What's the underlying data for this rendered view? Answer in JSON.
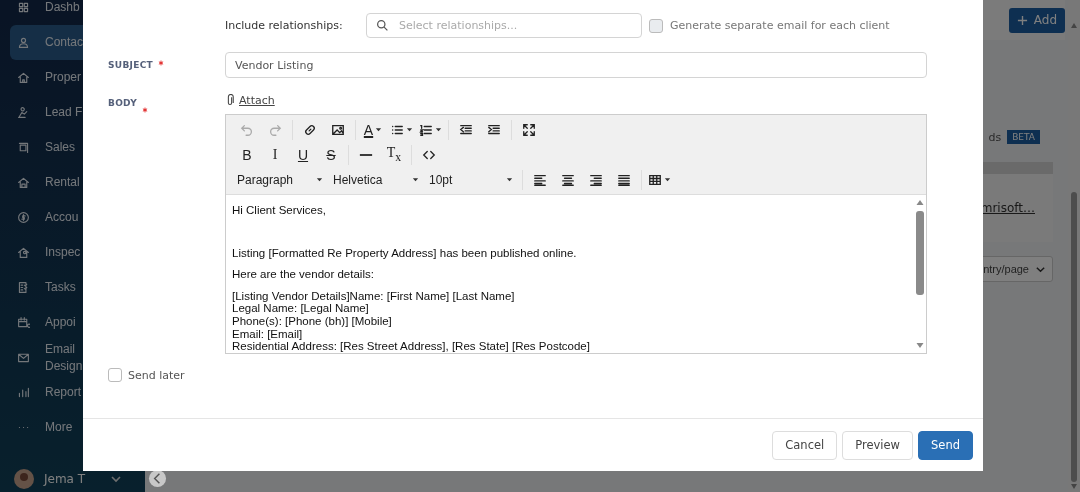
{
  "sidebar": {
    "items": [
      {
        "label": "Dashb",
        "selected": false
      },
      {
        "label": "Contac",
        "selected": true
      },
      {
        "label": "Proper",
        "selected": false
      },
      {
        "label": "Lead F",
        "selected": false
      },
      {
        "label": "Sales",
        "selected": false
      },
      {
        "label": "Rental",
        "selected": false
      },
      {
        "label": "Accou",
        "selected": false
      },
      {
        "label": "Inspec",
        "selected": false
      },
      {
        "label": "Tasks",
        "selected": false
      },
      {
        "label": "Appoi",
        "selected": false
      },
      {
        "label": "Email Design",
        "selected": false
      },
      {
        "label": "Report",
        "selected": false
      },
      {
        "label": "More",
        "selected": false
      }
    ],
    "user": {
      "name": "Jema T"
    }
  },
  "background": {
    "add_button": "Add",
    "feature_label": "ds",
    "feature_badge": "BETA",
    "table_link": "mrisoft…",
    "page_size": "ntry/page"
  },
  "modal": {
    "relationships": {
      "label": "Include relationships:",
      "placeholder": "Select relationships..."
    },
    "separate_email": {
      "label": "Generate separate email for each client",
      "checked": false
    },
    "subject": {
      "label": "SUBJECT",
      "required": true,
      "value": "Vendor Listing"
    },
    "body": {
      "label": "BODY",
      "required": true,
      "attach": "Attach",
      "toolbar": [
        [
          [
            {
              "kind": "undo",
              "disabled": true
            },
            {
              "kind": "redo",
              "disabled": true
            }
          ],
          [
            {
              "kind": "link",
              "disabled": false
            },
            {
              "kind": "image",
              "disabled": false
            }
          ],
          [
            {
              "kind": "forecolor",
              "glyph": "A",
              "disabled": false
            },
            {
              "kind": "bullist",
              "disabled": false
            },
            {
              "kind": "numlist",
              "disabled": false
            }
          ],
          [
            {
              "kind": "outdent",
              "disabled": false
            },
            {
              "kind": "indent",
              "disabled": false
            }
          ],
          [
            {
              "kind": "fullscreen",
              "disabled": false
            }
          ]
        ],
        [
          [
            {
              "kind": "bold",
              "glyph": "B",
              "disabled": false
            },
            {
              "kind": "italic",
              "glyph": "I",
              "disabled": false
            },
            {
              "kind": "underline",
              "glyph": "U",
              "disabled": false
            },
            {
              "kind": "strike",
              "glyph": "S",
              "disabled": false
            }
          ],
          [
            {
              "kind": "hr",
              "disabled": false
            },
            {
              "kind": "removeformat",
              "glyph": "T$_{x}$",
              "disabled": false
            }
          ],
          [
            {
              "kind": "code",
              "disabled": false
            }
          ]
        ],
        [
          [
            {
              "kind": "select",
              "value": "Paragraph",
              "disabled": false
            },
            {
              "kind": "select",
              "value": "Helvetica",
              "disabled": false
            },
            {
              "kind": "select",
              "value": "10pt",
              "disabled": false
            }
          ],
          [
            {
              "kind": "alignleft",
              "disabled": false
            },
            {
              "kind": "aligncenter",
              "disabled": false
            },
            {
              "kind": "alignright",
              "disabled": false
            },
            {
              "kind": "justify",
              "disabled": false
            }
          ],
          [
            {
              "kind": "table",
              "disabled": false
            }
          ]
        ]
      ],
      "content": [
        {
          "lines": [
            "Hi Client Services,"
          ]
        },
        {
          "lines": [
            "Listing [Formatted Re Property Address] has been published online."
          ]
        },
        {
          "lines": [
            "Here are the vendor details:"
          ]
        },
        {
          "lines": [
            "[Listing Vendor Details]Name: [First Name] [Last Name]",
            "Legal Name: [Legal Name]",
            "Phone(s): [Phone (bh)] [Mobile]",
            "Email: [Email]",
            "Residential Address: [Res Street Address], [Res State] [Res Postcode]"
          ]
        }
      ]
    },
    "send_later": {
      "label": "Send later",
      "checked": false
    },
    "buttons": [
      {
        "label": "Cancel",
        "kind": "secondary"
      },
      {
        "label": "Preview",
        "kind": "secondary"
      },
      {
        "label": "Send",
        "kind": "primary"
      }
    ]
  }
}
